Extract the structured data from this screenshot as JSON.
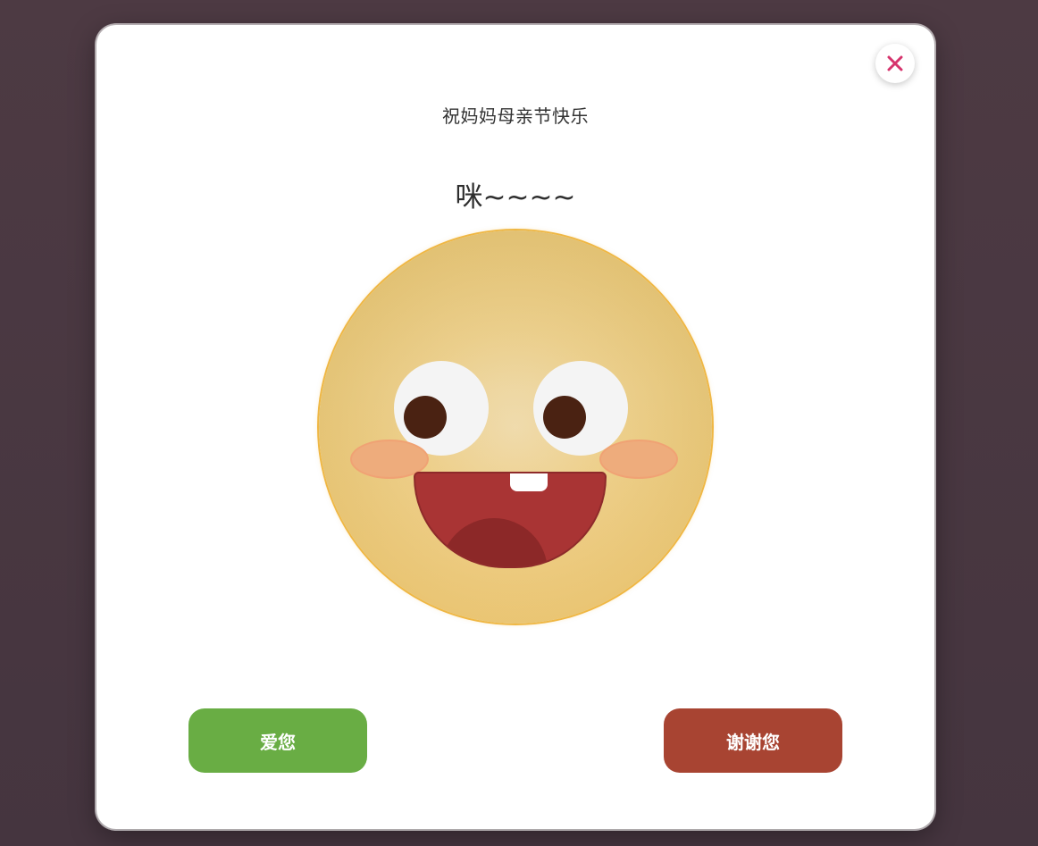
{
  "dialog": {
    "title": "祝妈妈母亲节快乐",
    "subtitle": "咪~~~~",
    "close_icon": "close-icon"
  },
  "face": {
    "icon": "smiling-face-icon",
    "colors": {
      "skin": "#ecd08e",
      "outline": "#efb744",
      "eyes": "#f4f4f4",
      "pupils": "#4a2212",
      "cheeks": "#eeac7c",
      "mouth": "#a93434",
      "tongue": "#8c2828"
    }
  },
  "buttons": {
    "love_label": "爱您",
    "love_color": "#69ad44",
    "thanks_label": "谢谢您",
    "thanks_color": "#a84432"
  },
  "colors": {
    "backdrop": "#4a3740",
    "close_icon": "#d6336c"
  }
}
